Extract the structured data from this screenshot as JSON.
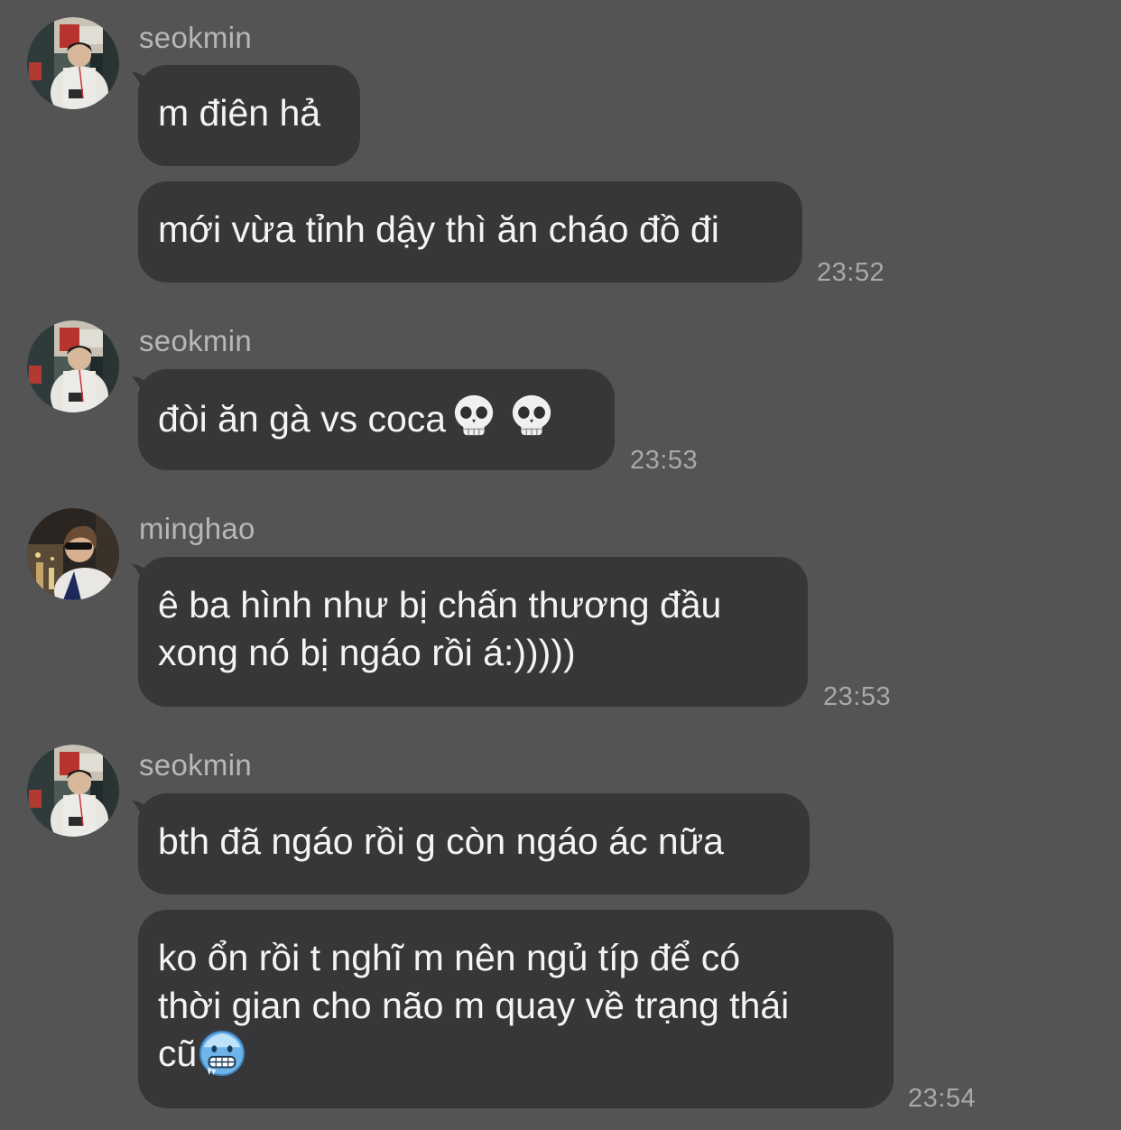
{
  "messages": [
    {
      "sender": "seokmin",
      "avatar_icon": "seokmin-avatar",
      "bubbles": [
        {
          "text": "m điên hả"
        },
        {
          "text": "mới vừa tỉnh dậy thì ăn cháo đồ đi",
          "time": "23:52"
        }
      ]
    },
    {
      "sender": "seokmin",
      "avatar_icon": "seokmin-avatar",
      "bubbles": [
        {
          "text": "đòi ăn gà vs coca",
          "emoji": [
            "skull",
            "skull"
          ],
          "time": "23:53"
        }
      ]
    },
    {
      "sender": "minghao",
      "avatar_icon": "minghao-avatar",
      "bubbles": [
        {
          "lines": [
            "ê ba hình như bị chấn thương đầu",
            "xong nó bị ngáo rồi á:)))))"
          ],
          "time": "23:53"
        }
      ]
    },
    {
      "sender": "seokmin",
      "avatar_icon": "seokmin-avatar",
      "bubbles": [
        {
          "text": "bth đã ngáo rồi g còn ngáo ác nữa"
        },
        {
          "lines": [
            "ko ổn rồi t nghĩ m nên ngủ típ để có",
            "thời gian cho não m quay về trạng thái",
            "cũ"
          ],
          "emoji": [
            "cold-face"
          ],
          "time": "23:54"
        }
      ]
    }
  ],
  "colors": {
    "background": "#555455",
    "bubble": "#373638",
    "text": "#f4f4f5",
    "meta": "#b7b6b8"
  }
}
